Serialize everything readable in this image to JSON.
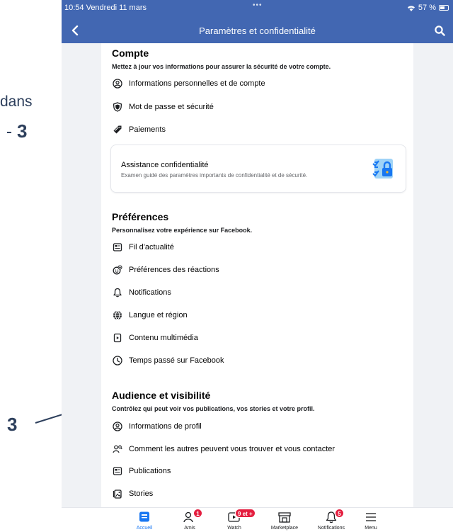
{
  "annotation": {
    "text_top": "dans",
    "number_top": "3",
    "number_left": "3"
  },
  "status_bar": {
    "time_date": "10:54  Vendredi 11 mars",
    "dots": "•••",
    "battery": "57 %"
  },
  "header": {
    "title": "Paramètres et confidentialité"
  },
  "compte": {
    "title": "Compte",
    "subtitle": "Mettez à jour vos informations pour assurer la sécurité de votre compte.",
    "items": [
      {
        "label": "Informations personnelles et de compte",
        "icon": "user-circle-icon"
      },
      {
        "label": "Mot de passe et sécurité",
        "icon": "shield-icon"
      },
      {
        "label": "Paiements",
        "icon": "tag-icon"
      }
    ]
  },
  "card": {
    "title": "Assistance confidentialité",
    "description": "Examen guidé des paramètres importants de confidentialité et de sécurité.",
    "icon": "privacy-lock-icon"
  },
  "preferences": {
    "title": "Préférences",
    "subtitle": "Personnalisez votre expérience sur Facebook.",
    "items": [
      {
        "label": "Fil d'actualité",
        "icon": "news-feed-icon"
      },
      {
        "label": "Préférences des réactions",
        "icon": "reactions-icon"
      },
      {
        "label": "Notifications",
        "icon": "bell-icon"
      },
      {
        "label": "Langue et région",
        "icon": "globe-icon"
      },
      {
        "label": "Contenu multimédia",
        "icon": "media-icon"
      },
      {
        "label": "Temps passé sur Facebook",
        "icon": "clock-icon"
      }
    ]
  },
  "audience": {
    "title": "Audience et visibilité",
    "subtitle": "Contrôlez qui peut voir vos publications, vos stories et votre profil.",
    "items": [
      {
        "label": "Informations de profil",
        "icon": "user-circle-icon"
      },
      {
        "label": "Comment les autres peuvent vous trouver et vous contacter",
        "icon": "people-search-icon"
      },
      {
        "label": "Publications",
        "icon": "posts-icon"
      },
      {
        "label": "Stories",
        "icon": "stories-icon"
      }
    ]
  },
  "tabbar": {
    "tabs": [
      {
        "label": "Accueil",
        "icon": "home-icon",
        "active": true
      },
      {
        "label": "Amis",
        "icon": "friends-icon",
        "badge": "1"
      },
      {
        "label": "Watch",
        "icon": "watch-icon",
        "badge": "9 et +"
      },
      {
        "label": "Marketplace",
        "icon": "marketplace-icon"
      },
      {
        "label": "Notifications",
        "icon": "bell-icon",
        "badge": "5"
      },
      {
        "label": "Menu",
        "icon": "menu-icon"
      }
    ]
  },
  "colors": {
    "brand": "#4267b2",
    "accent": "#1877f2",
    "badge": "#e41e3f",
    "annotation": "#2d3f5c"
  }
}
